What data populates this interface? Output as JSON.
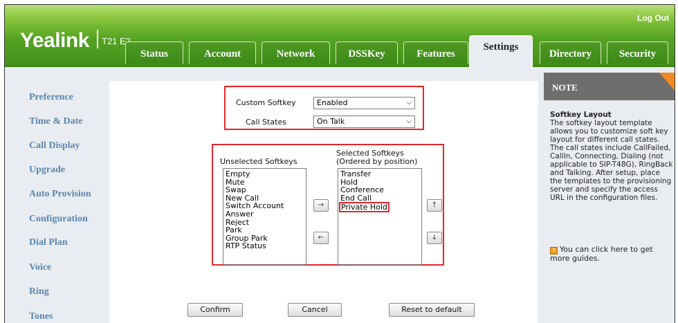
{
  "header": {
    "logo": "Yealink",
    "model": "T21 E2",
    "logout": "Log Out"
  },
  "tabs": [
    {
      "label": "Status",
      "active": false
    },
    {
      "label": "Account",
      "active": false
    },
    {
      "label": "Network",
      "active": false
    },
    {
      "label": "DSSKey",
      "active": false
    },
    {
      "label": "Features",
      "active": false
    },
    {
      "label": "Settings",
      "active": true
    },
    {
      "label": "Directory",
      "active": false
    },
    {
      "label": "Security",
      "active": false
    }
  ],
  "sidebar": {
    "items": [
      "Preference",
      "Time & Date",
      "Call Display",
      "Upgrade",
      "Auto Provision",
      "Configuration",
      "Dial Plan",
      "Voice",
      "Ring",
      "Tones"
    ]
  },
  "form": {
    "custom_softkey_label": "Custom Softkey",
    "custom_softkey_value": "Enabled",
    "call_states_label": "Call States",
    "call_states_value": "On Talk",
    "unselected_label": "Unselected Softkeys",
    "selected_label_1": "Selected Softkeys",
    "selected_label_2": "(Ordered by position)",
    "unselected_items": [
      "Empty",
      "Mute",
      "Swap",
      "New Call",
      "Switch Account",
      "Answer",
      "Reject",
      "Park",
      "Group Park",
      "RTP Status"
    ],
    "selected_items": [
      "Transfer",
      "Hold",
      "Conference",
      "End Call",
      "Private Hold"
    ],
    "move_right": "→",
    "move_left": "←",
    "move_up": "↑",
    "move_down": "↓",
    "confirm": "Confirm",
    "cancel": "Cancel",
    "reset": "Reset to default"
  },
  "note": {
    "title": "NOTE",
    "subtitle": "Softkey Layout",
    "body": "The softkey layout template allows you to customize soft key layout for different call states. The call states include CallFailed, CallIn, Connecting, Dialing (not applicable to SIP-T48G), RingBack and Talking. After setup, place the templates to the provisioning server and specify the access URL in the configuration files.",
    "guide_icon": "?",
    "guide": "You can click here to get more guides."
  },
  "colors": {
    "header_green": "#54a323",
    "highlight_red": "#e0262b",
    "sidebar_link": "#5a86b0",
    "note_accent": "#f08a24"
  }
}
